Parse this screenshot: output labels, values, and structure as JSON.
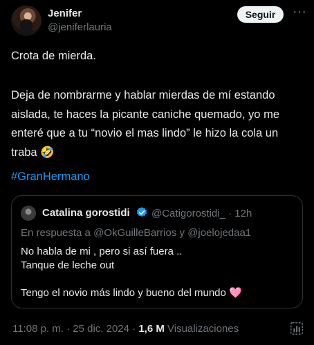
{
  "author": {
    "name": "Jenifer",
    "handle": "@jeniferlauria"
  },
  "follow_label": "Seguir",
  "more_glyph": "···",
  "tweet": {
    "line1": "Crota de mierda.",
    "paragraph2": "Deja de nombrarme y hablar mierdas de mí estando aislada, te haces la picante caniche quemado, yo me enteré que a tu “novio el mas lindo” le hizo la cola un traba 🤣",
    "hashtag": "#GranHermano"
  },
  "quoted": {
    "name": "Catalina gorostidi",
    "handle": "@Catigorostidi_",
    "time": "· 12h",
    "reply_prefix": "En respuesta a ",
    "reply_user1": "@OkGuilleBarrios",
    "reply_join": " y ",
    "reply_user2": "@joelojedaa1",
    "text_line1": "No habla de mi , pero si así fuera ..",
    "text_line2": "Tanque de leche out",
    "text_line3": "Tengo el novio más lindo y bueno del mundo 🩷"
  },
  "meta": {
    "time": "11:08 p. m. · 25 dic. 2024 · ",
    "views_count": "1,6 M",
    "views_label": " Visualizaciones"
  },
  "colors": {
    "background": "#000000",
    "link": "#1d9bf0",
    "muted": "#71767b",
    "text": "#e7e9ea",
    "border": "#2f3336"
  },
  "icons": [
    "more-icon",
    "verified-badge-icon",
    "view-stats-icon"
  ]
}
